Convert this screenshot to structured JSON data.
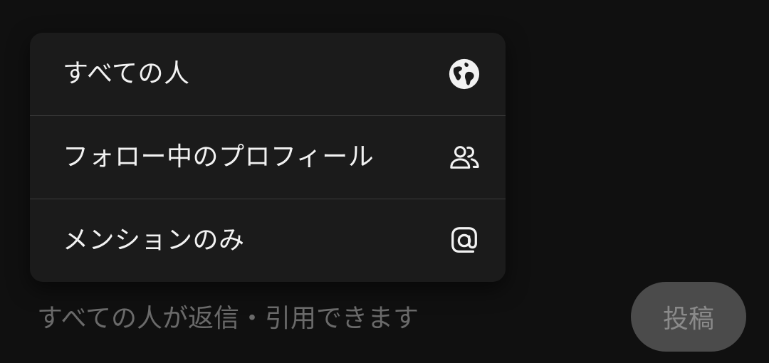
{
  "audience_menu": {
    "items": [
      {
        "label": "すべての人",
        "icon": "globe-icon"
      },
      {
        "label": "フォロー中のプロフィール",
        "icon": "people-icon"
      },
      {
        "label": "メンションのみ",
        "icon": "at-sign-icon"
      }
    ]
  },
  "composer": {
    "reply_hint": "すべての人が返信・引用できます",
    "post_label": "投稿"
  },
  "colors": {
    "background": "#101010",
    "menu_background": "#1b1b1b",
    "divider": "#3a3a3a",
    "text": "#f2f2f2",
    "muted_text": "#6a6a6a",
    "button_background": "#4b4b4b"
  }
}
